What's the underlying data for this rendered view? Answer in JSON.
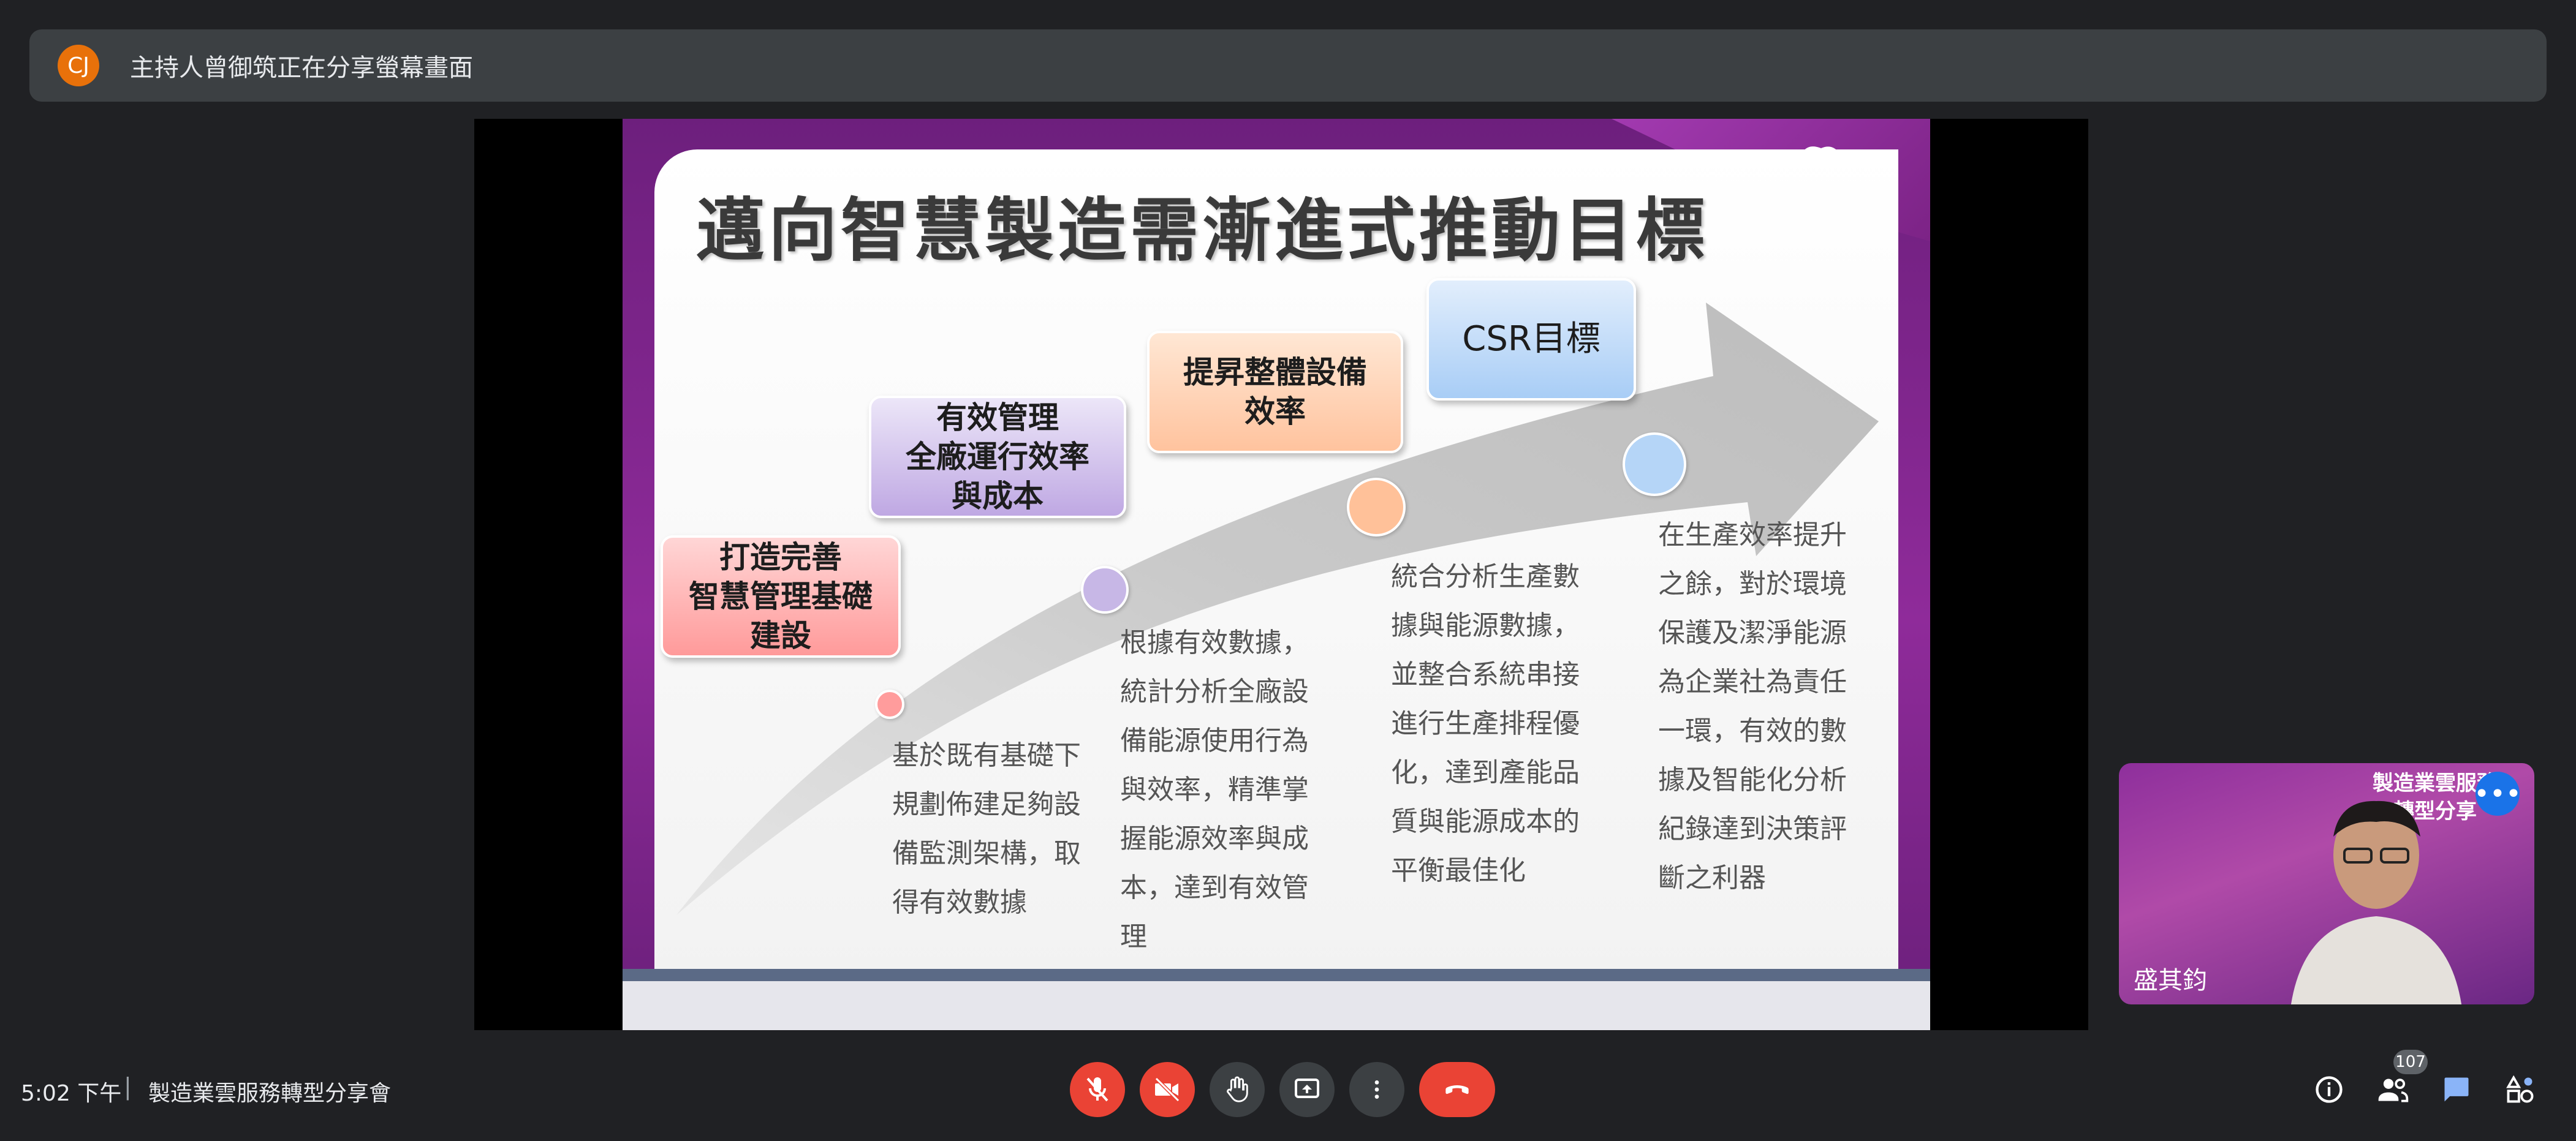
{
  "banner": {
    "avatar_initials": "CJ",
    "text": "主持人曾御筑正在分享螢幕畫面"
  },
  "slide": {
    "title": "邁向智慧製造需漸進式推動目標",
    "boxes": [
      {
        "label": "打造完善\n智慧管理基礎\n建設"
      },
      {
        "label": "有效管理\n全廠運行效率\n與成本"
      },
      {
        "label": "提昇整體設備\n效率"
      },
      {
        "label": "CSR目標"
      }
    ],
    "descriptions": [
      "基於既有基礎下\n規劃佈建足夠設\n備監測架構，取\n得有效數據",
      "根據有效數據，\n統計分析全廠設\n備能源使用行為\n與效率，精準掌\n握能源效率與成\n本，達到有效管\n理",
      "統合分析生產數\n據與能源數據，\n並整合系統串接\n進行生產排程優\n化，達到產能品\n質與能源成本的\n平衡最佳化",
      "在生產效率提升\n之餘，對於環境\n保護及潔淨能源\n為企業社為責任\n一環，有效的數\n據及智能化分析\n紀錄達到決策評\n斷之利器"
    ]
  },
  "self_view": {
    "bg_text": "製造業雲服務\n轉型分享",
    "name": "盛其鈞"
  },
  "bottom_bar": {
    "time": "5:02 下午",
    "separator": "|",
    "meeting_title": "製造業雲服務轉型分享會",
    "participants_count": "107"
  },
  "colors": {
    "accent_red": "#ea4335",
    "bar_bg": "#202124",
    "banner_bg": "#3c4043",
    "slide_purple": "#8f2b9a"
  },
  "icons": {
    "mic": "mic-off-icon",
    "camera": "camera-off-icon",
    "hand": "raise-hand-icon",
    "present": "present-screen-icon",
    "more": "more-vert-icon",
    "end_call": "end-call-icon",
    "info": "info-icon",
    "people": "people-icon",
    "chat": "chat-icon",
    "activities": "activities-icon"
  }
}
